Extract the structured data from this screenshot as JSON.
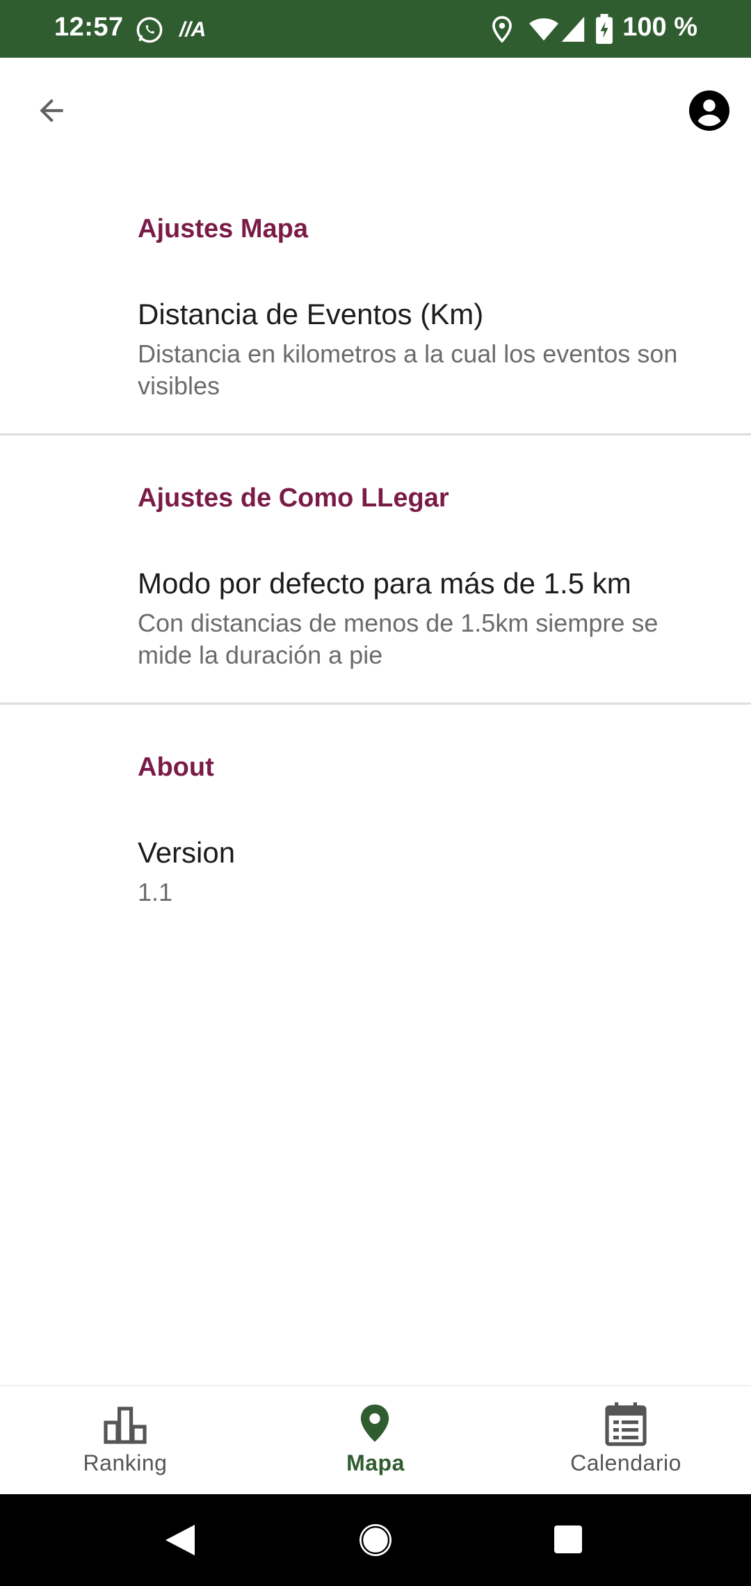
{
  "status_bar": {
    "time": "12:57",
    "battery_text": "100 %",
    "background_color": "#2f5d2f",
    "icons": [
      "whatsapp-icon",
      "carrier-icon",
      "location-icon",
      "wifi-icon",
      "signal-icon",
      "battery-charging-icon"
    ],
    "carrier_text": "//A"
  },
  "top_bar": {
    "back_icon": "arrow-back-icon",
    "account_icon": "account-circle-icon"
  },
  "settings": {
    "sections": [
      {
        "category": "Ajustes Mapa",
        "pref_title": "Distancia de Eventos (Km)",
        "pref_summary": "Distancia en kilometros a la cual los eventos son visibles"
      },
      {
        "category": "Ajustes de Como LLegar",
        "pref_title": "Modo por defecto para más de 1.5 km",
        "pref_summary": "Con distancias de menos de 1.5km siempre se mide la duración a pie"
      },
      {
        "category": "About",
        "pref_title": "Version",
        "pref_summary": "1.1"
      }
    ],
    "category_color": "#7a1b47"
  },
  "bottom_nav": {
    "items": [
      {
        "label": "Ranking",
        "icon": "ranking-icon",
        "active": false
      },
      {
        "label": "Mapa",
        "icon": "map-pin-icon",
        "active": true
      },
      {
        "label": "Calendario",
        "icon": "calendar-icon",
        "active": false
      }
    ],
    "active_color": "#2f5d2f"
  },
  "system_nav": {
    "buttons": [
      "back-triangle-icon",
      "home-circle-icon",
      "recents-square-icon"
    ]
  }
}
